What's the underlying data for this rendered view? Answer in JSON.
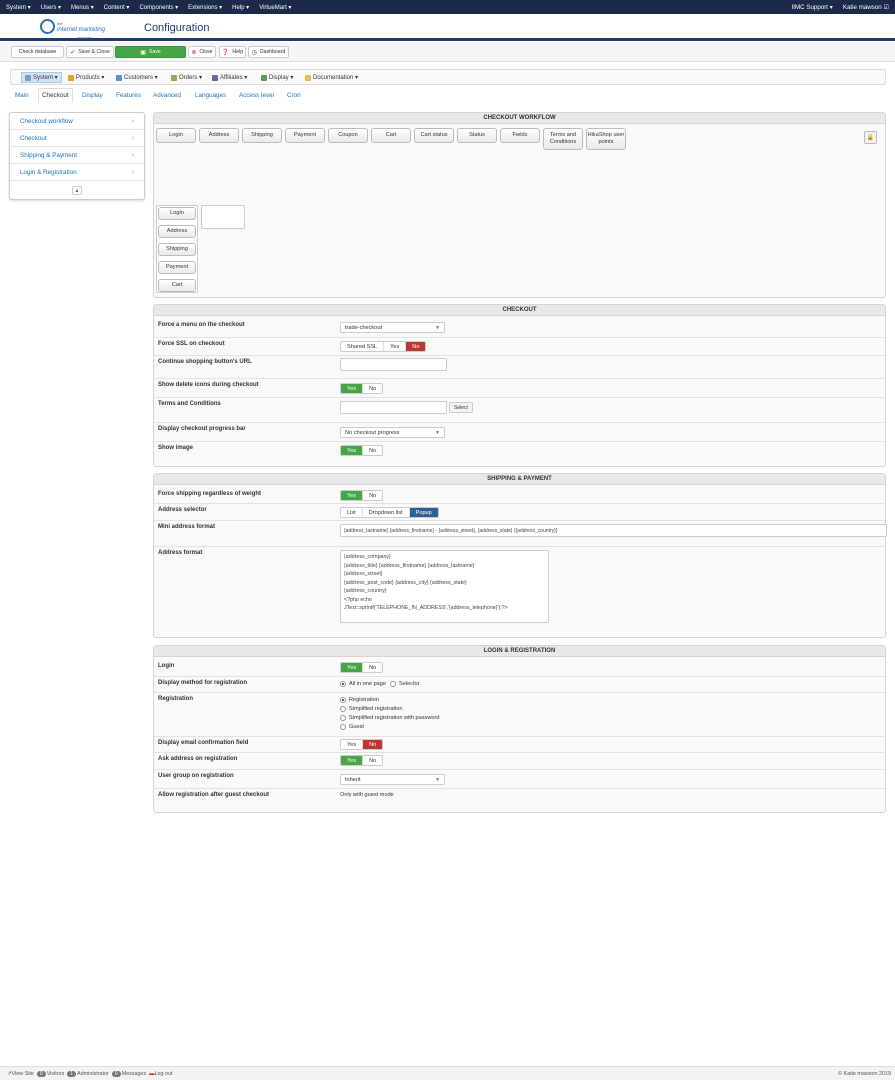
{
  "topmenu": {
    "items": [
      "System ▾",
      "Users ▾",
      "Menus ▾",
      "Content ▾",
      "Components ▾",
      "Extensions ▾",
      "Help ▾",
      "VirtueMart ▾"
    ],
    "support": "IIMC Support ▾",
    "user": "Katie mawson ☑"
  },
  "header": {
    "logo_line1": "the",
    "logo_line2": "internet marketing",
    "logo_line3": "company",
    "title": "Configuration"
  },
  "toolbar": {
    "check_database": "Check database",
    "save_close": "Save & Close",
    "save": "Save",
    "close": "Close",
    "help": "Help",
    "dashboard": "Dashboard"
  },
  "menubar": [
    "System ▾",
    "Products ▾",
    "Customers ▾",
    "Orders ▾",
    "Affiliates ▾",
    "Display ▾",
    "Documentation ▾"
  ],
  "subnav": [
    "Main",
    "Checkout",
    "Display",
    "Features",
    "Advanced",
    "Languages",
    "Access level",
    "Cron"
  ],
  "sidebar": [
    "Checkout workflow",
    "Checkout",
    "Shipping & Payment",
    "Login & Registration"
  ],
  "workflow": {
    "title": "CHECKOUT WORKFLOW",
    "buttons": [
      "Login",
      "Address",
      "Shipping",
      "Payment",
      "Coupon",
      "Cart",
      "Cart status",
      "Status",
      "Fields",
      "Terms and Conditions",
      "HikaShop user points"
    ],
    "step": [
      "Login",
      "Address",
      "Shipping",
      "Payment",
      "Cart"
    ]
  },
  "checkout": {
    "title": "CHECKOUT",
    "force_menu_label": "Force a menu on the checkout",
    "force_menu_value": "trade-checkout",
    "force_ssl_label": "Force SSL on checkout",
    "force_ssl_opts": [
      "Shared SSL",
      "Yes",
      "No"
    ],
    "continue_label": "Continue shopping button's URL",
    "delete_icons_label": "Show delete icons during checkout",
    "terms_label": "Terms and Conditions",
    "select_btn": "Select",
    "progress_label": "Display checkout progress bar",
    "progress_value": "No checkout progress",
    "show_image_label": "Show image",
    "yes": "Yes",
    "no": "No"
  },
  "shipping": {
    "title": "SHIPPING & PAYMENT",
    "force_weight_label": "Force shipping regardless of weight",
    "address_selector_label": "Address selector",
    "address_selector_opts": [
      "List",
      "Dropdown list",
      "Popup"
    ],
    "mini_address_label": "Mini address format",
    "mini_address_value": "{address_lastname} {address_firstname} - {address_street}, {address_state} ({address_country})",
    "address_format_label": "Address format",
    "address_format_value": "{address_company}\n{address_title} {address_firstname} {address_lastname}\n{address_street}\n{address_post_code} {address_city} {address_state}\n{address_country}\n<?php echo\nJText::sprintf('TELEPHONE_IN_ADDRESS','{address_telephone}');?>"
  },
  "login": {
    "title": "LOGIN & REGISTRATION",
    "login_label": "Login",
    "display_method_label": "Display method for registration",
    "display_method_opts": [
      "All in one page",
      "Selector"
    ],
    "registration_label": "Registration",
    "registration_opts": [
      "Registration",
      "Simplified registration",
      "Simplified registration with password",
      "Guest"
    ],
    "email_confirm_label": "Display email confirmation field",
    "ask_address_label": "Ask address on registration",
    "user_group_label": "User group on registration",
    "user_group_value": "Inherit",
    "allow_guest_label": "Allow registration after guest checkout",
    "allow_guest_value": "Only with guest mode"
  },
  "footer": {
    "view_site": "View Site",
    "visitors_count": "0",
    "visitors": "Visitors",
    "admins_count": "1",
    "admins": "Administrator",
    "messages_count": "0",
    "messages": "Messages",
    "logout": "Log out",
    "copyright": "© Katie mawson 2019"
  },
  "colors": {
    "navy": "#1a2b4a",
    "green": "#46a546",
    "red": "#bd362f",
    "blue": "#2f5f9a",
    "link": "#1a73b8"
  }
}
